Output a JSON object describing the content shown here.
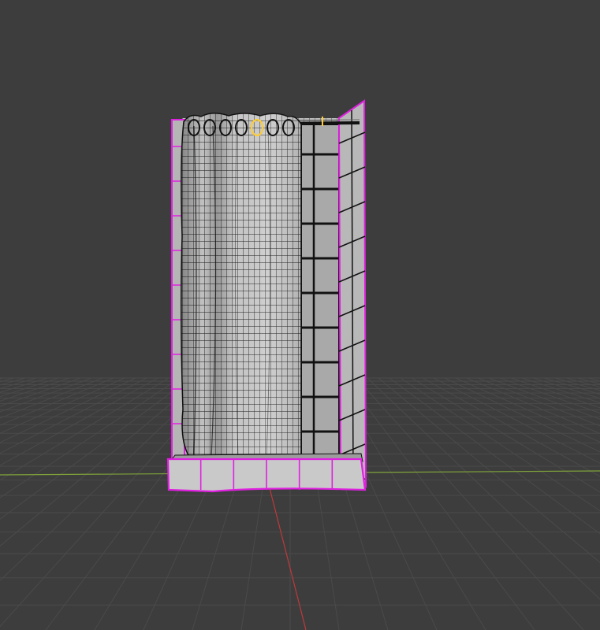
{
  "viewport": {
    "background": "#3d3d3d",
    "grid_color": "#4a4a4a",
    "x_axis_color": "#7fa33a",
    "y_axis_color": "#c0393b"
  },
  "model": {
    "selection_outline_color": "#e020e0",
    "active_element_color": "#ffcc33",
    "mesh_surface_color": "#cfcfcf",
    "wire_color": "#111111",
    "curtain_rings": 7,
    "tile_columns_front": 6
  }
}
